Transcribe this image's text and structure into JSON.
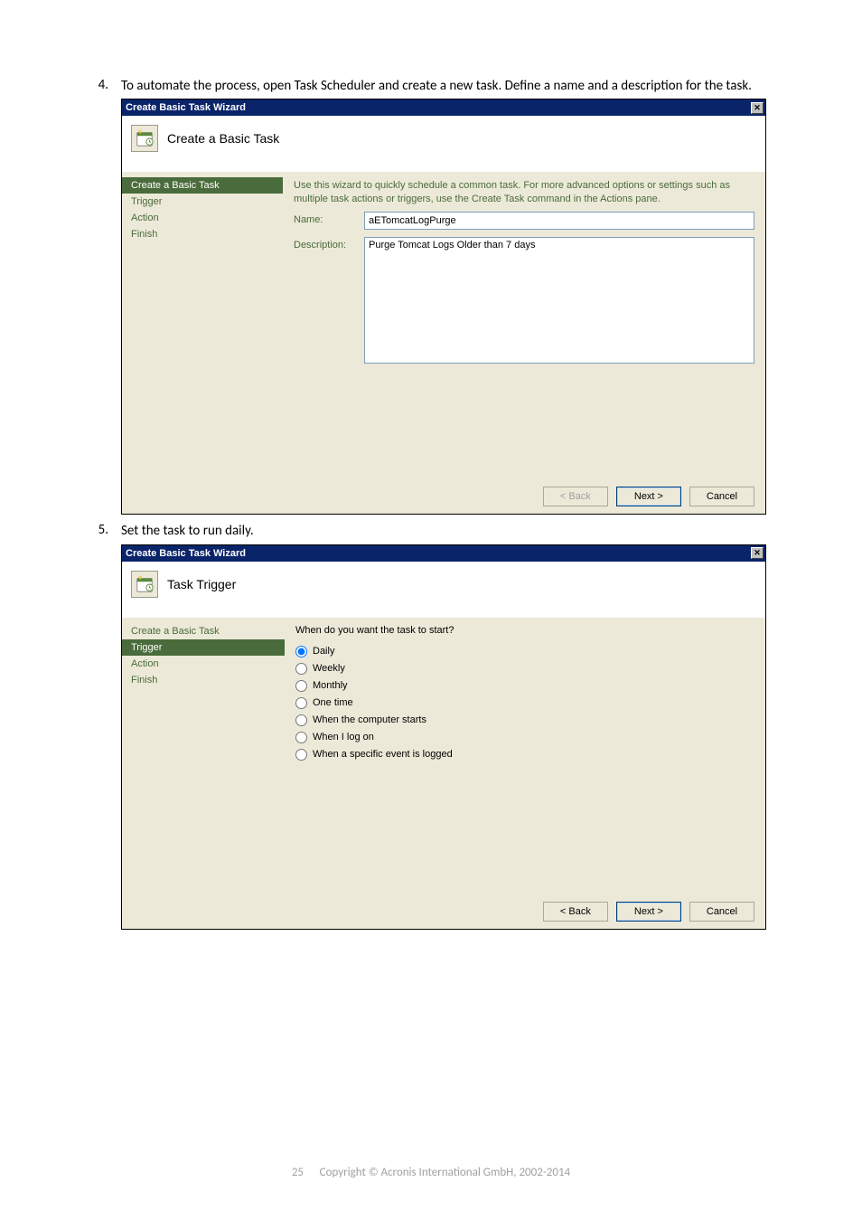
{
  "doc": {
    "item4_num": "4.",
    "item4_text": "To automate the process, open Task Scheduler and create a new task. Define a name and a description for the task.",
    "item5_num": "5.",
    "item5_text": "Set the task to run daily."
  },
  "dlg1": {
    "title": "Create Basic Task Wizard",
    "header": "Create a Basic Task",
    "sidebar": {
      "create": "Create a Basic Task",
      "trigger": "Trigger",
      "action": "Action",
      "finish": "Finish"
    },
    "hint": "Use this wizard to quickly schedule a common task. For more advanced options or settings such as multiple task actions or triggers, use the Create Task command in the Actions pane.",
    "name_label": "Name:",
    "name_value": "aETomcatLogPurge",
    "desc_label": "Description:",
    "desc_value": "Purge Tomcat Logs Older than 7 days",
    "back": "< Back",
    "next": "Next >",
    "cancel": "Cancel"
  },
  "dlg2": {
    "title": "Create Basic Task Wizard",
    "header": "Task Trigger",
    "sidebar": {
      "create": "Create a Basic Task",
      "trigger": "Trigger",
      "action": "Action",
      "finish": "Finish"
    },
    "prompt": "When do you want the task to start?",
    "opts": {
      "daily": "Daily",
      "weekly": "Weekly",
      "monthly": "Monthly",
      "onetime": "One time",
      "computer": "When the computer starts",
      "logon": "When I log on",
      "event": "When a specific event is logged"
    },
    "back": "< Back",
    "next": "Next >",
    "cancel": "Cancel"
  },
  "footer": {
    "page": "25",
    "copyright": "Copyright © Acronis International GmbH, 2002-2014"
  }
}
